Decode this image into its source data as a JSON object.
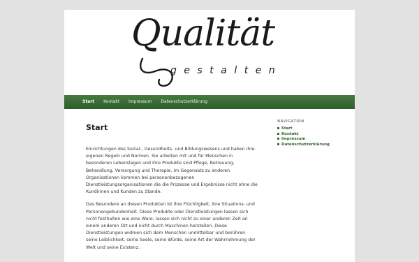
{
  "header": {
    "logo_word": "Qualität",
    "logo_sub": "gestalten"
  },
  "nav": {
    "items": [
      "Start",
      "Kontakt",
      "Impressum",
      "Datenschutzerklärung"
    ],
    "current": "Start"
  },
  "main": {
    "title": "Start",
    "paragraphs": [
      "Einrichtungen des Sozial-, Gesundheits- und Bildungswesens und haben ihre eigenen Regeln und Normen. Sie arbeiten mit und für Menschen in besonderen Lebenslagen und ihre Produkte sind Pflege, Betreuung, Behandlung, Versorgung und Therapie. Im Gegensatz zu anderen Organisationen kommen bei personenbezogenen Dienstleistungsorganisationen die die Prozesse und Ergebnisse nicht ohne die Kundinnen und Kunden zu Stande.",
      "Das Besondere an diesen Produkten ist ihre Flüchtigkeit, ihre Situations- und Personengebundenheit. Diese Produkte oder Dienstleistungen lassen sich nicht festhalten wie eine Ware, lassen sich nicht zu einer anderen Zeit an einem anderen Ort und nicht durch Maschinen herstellen. Diese Dienstleistungen widmen sich dem Menschen unmittelbar und berühren seine Leiblichkeit, seine Seele, seine Würde, seine Art der Wahrnehmung der Welt und seine Existenz."
    ]
  },
  "sidebar": {
    "widget_title": "Navigation",
    "items": [
      "Start",
      "Kontakt",
      "Impressum",
      "Datenschutzerklärung"
    ]
  },
  "colors": {
    "nav_green": "#3a6e37",
    "page_bg": "#e2e2e2",
    "content_bg": "#ffffff"
  }
}
